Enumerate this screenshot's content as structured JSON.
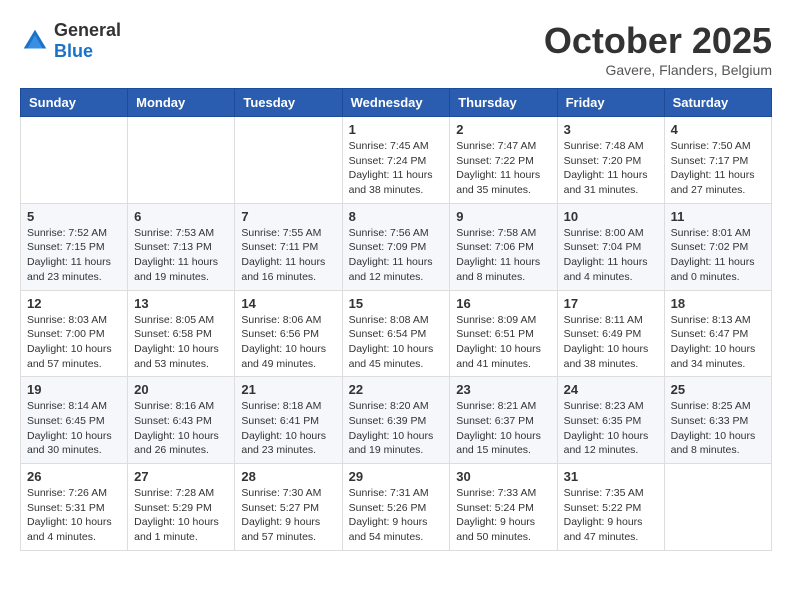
{
  "header": {
    "logo_general": "General",
    "logo_blue": "Blue",
    "month_title": "October 2025",
    "location": "Gavere, Flanders, Belgium"
  },
  "days_of_week": [
    "Sunday",
    "Monday",
    "Tuesday",
    "Wednesday",
    "Thursday",
    "Friday",
    "Saturday"
  ],
  "weeks": [
    [
      {
        "day": "",
        "info": ""
      },
      {
        "day": "",
        "info": ""
      },
      {
        "day": "",
        "info": ""
      },
      {
        "day": "1",
        "info": "Sunrise: 7:45 AM\nSunset: 7:24 PM\nDaylight: 11 hours\nand 38 minutes."
      },
      {
        "day": "2",
        "info": "Sunrise: 7:47 AM\nSunset: 7:22 PM\nDaylight: 11 hours\nand 35 minutes."
      },
      {
        "day": "3",
        "info": "Sunrise: 7:48 AM\nSunset: 7:20 PM\nDaylight: 11 hours\nand 31 minutes."
      },
      {
        "day": "4",
        "info": "Sunrise: 7:50 AM\nSunset: 7:17 PM\nDaylight: 11 hours\nand 27 minutes."
      }
    ],
    [
      {
        "day": "5",
        "info": "Sunrise: 7:52 AM\nSunset: 7:15 PM\nDaylight: 11 hours\nand 23 minutes."
      },
      {
        "day": "6",
        "info": "Sunrise: 7:53 AM\nSunset: 7:13 PM\nDaylight: 11 hours\nand 19 minutes."
      },
      {
        "day": "7",
        "info": "Sunrise: 7:55 AM\nSunset: 7:11 PM\nDaylight: 11 hours\nand 16 minutes."
      },
      {
        "day": "8",
        "info": "Sunrise: 7:56 AM\nSunset: 7:09 PM\nDaylight: 11 hours\nand 12 minutes."
      },
      {
        "day": "9",
        "info": "Sunrise: 7:58 AM\nSunset: 7:06 PM\nDaylight: 11 hours\nand 8 minutes."
      },
      {
        "day": "10",
        "info": "Sunrise: 8:00 AM\nSunset: 7:04 PM\nDaylight: 11 hours\nand 4 minutes."
      },
      {
        "day": "11",
        "info": "Sunrise: 8:01 AM\nSunset: 7:02 PM\nDaylight: 11 hours\nand 0 minutes."
      }
    ],
    [
      {
        "day": "12",
        "info": "Sunrise: 8:03 AM\nSunset: 7:00 PM\nDaylight: 10 hours\nand 57 minutes."
      },
      {
        "day": "13",
        "info": "Sunrise: 8:05 AM\nSunset: 6:58 PM\nDaylight: 10 hours\nand 53 minutes."
      },
      {
        "day": "14",
        "info": "Sunrise: 8:06 AM\nSunset: 6:56 PM\nDaylight: 10 hours\nand 49 minutes."
      },
      {
        "day": "15",
        "info": "Sunrise: 8:08 AM\nSunset: 6:54 PM\nDaylight: 10 hours\nand 45 minutes."
      },
      {
        "day": "16",
        "info": "Sunrise: 8:09 AM\nSunset: 6:51 PM\nDaylight: 10 hours\nand 41 minutes."
      },
      {
        "day": "17",
        "info": "Sunrise: 8:11 AM\nSunset: 6:49 PM\nDaylight: 10 hours\nand 38 minutes."
      },
      {
        "day": "18",
        "info": "Sunrise: 8:13 AM\nSunset: 6:47 PM\nDaylight: 10 hours\nand 34 minutes."
      }
    ],
    [
      {
        "day": "19",
        "info": "Sunrise: 8:14 AM\nSunset: 6:45 PM\nDaylight: 10 hours\nand 30 minutes."
      },
      {
        "day": "20",
        "info": "Sunrise: 8:16 AM\nSunset: 6:43 PM\nDaylight: 10 hours\nand 26 minutes."
      },
      {
        "day": "21",
        "info": "Sunrise: 8:18 AM\nSunset: 6:41 PM\nDaylight: 10 hours\nand 23 minutes."
      },
      {
        "day": "22",
        "info": "Sunrise: 8:20 AM\nSunset: 6:39 PM\nDaylight: 10 hours\nand 19 minutes."
      },
      {
        "day": "23",
        "info": "Sunrise: 8:21 AM\nSunset: 6:37 PM\nDaylight: 10 hours\nand 15 minutes."
      },
      {
        "day": "24",
        "info": "Sunrise: 8:23 AM\nSunset: 6:35 PM\nDaylight: 10 hours\nand 12 minutes."
      },
      {
        "day": "25",
        "info": "Sunrise: 8:25 AM\nSunset: 6:33 PM\nDaylight: 10 hours\nand 8 minutes."
      }
    ],
    [
      {
        "day": "26",
        "info": "Sunrise: 7:26 AM\nSunset: 5:31 PM\nDaylight: 10 hours\nand 4 minutes."
      },
      {
        "day": "27",
        "info": "Sunrise: 7:28 AM\nSunset: 5:29 PM\nDaylight: 10 hours\nand 1 minute."
      },
      {
        "day": "28",
        "info": "Sunrise: 7:30 AM\nSunset: 5:27 PM\nDaylight: 9 hours\nand 57 minutes."
      },
      {
        "day": "29",
        "info": "Sunrise: 7:31 AM\nSunset: 5:26 PM\nDaylight: 9 hours\nand 54 minutes."
      },
      {
        "day": "30",
        "info": "Sunrise: 7:33 AM\nSunset: 5:24 PM\nDaylight: 9 hours\nand 50 minutes."
      },
      {
        "day": "31",
        "info": "Sunrise: 7:35 AM\nSunset: 5:22 PM\nDaylight: 9 hours\nand 47 minutes."
      },
      {
        "day": "",
        "info": ""
      }
    ]
  ]
}
